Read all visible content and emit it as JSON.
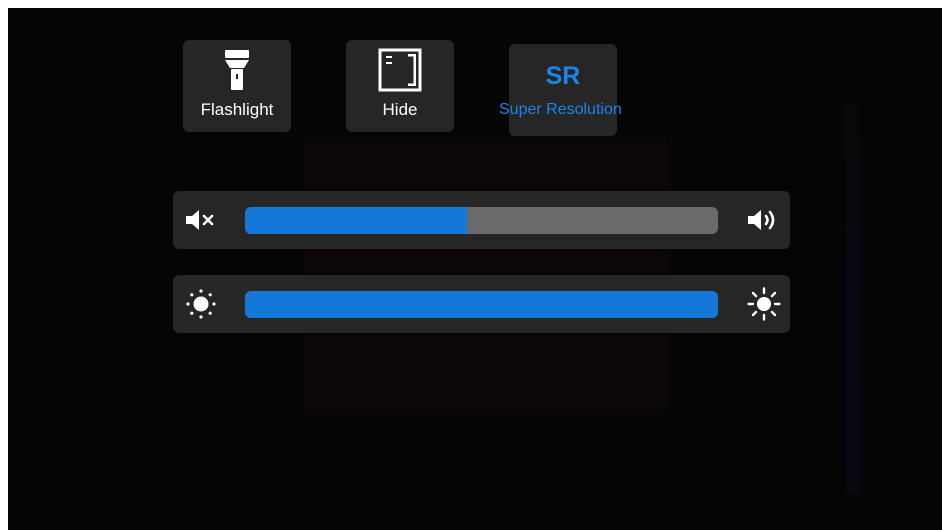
{
  "quick_tiles": [
    {
      "label": "Flashlight",
      "icon": "flashlight-icon"
    },
    {
      "label": "Hide",
      "icon": "hide-icon"
    },
    {
      "label": "Super Resolution",
      "glyph": "SR",
      "icon": "super-resolution-icon",
      "active": true
    }
  ],
  "volume": {
    "level": 0.47,
    "left_icon": "mute-icon",
    "right_icon": "volume-up-icon"
  },
  "brightness": {
    "level": 1.0,
    "left_icon": "brightness-low-icon",
    "right_icon": "brightness-high-icon"
  },
  "colors": {
    "accent": "#1478d8",
    "label_active": "#1a84ea",
    "panel": "#262626",
    "track": "#6a6a6a",
    "background": "#050505"
  }
}
